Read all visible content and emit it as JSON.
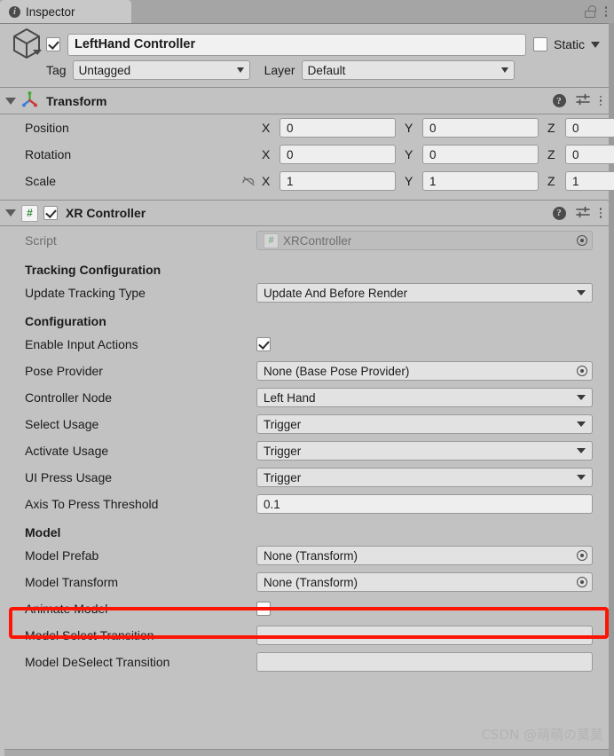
{
  "window": {
    "tab_label": "Inspector",
    "tab_icon": "info-icon",
    "lock_icon": "lock-open-icon",
    "menu_icon": "kebab-menu-icon"
  },
  "gameobject": {
    "icon": "cube-icon",
    "enabled": true,
    "name": "LeftHand Controller",
    "static_label": "Static",
    "static_checked": false,
    "tag_label": "Tag",
    "tag_value": "Untagged",
    "layer_label": "Layer",
    "layer_value": "Default"
  },
  "transform": {
    "icon": "transform-gizmo-icon",
    "title": "Transform",
    "help_icon": "help-icon",
    "preset_icon": "preset-sliders-icon",
    "menu_icon": "kebab-menu-icon",
    "rows": [
      {
        "label": "Position",
        "x": "0",
        "y": "0",
        "z": "0",
        "lock": false
      },
      {
        "label": "Rotation",
        "x": "0",
        "y": "0",
        "z": "0",
        "lock": false
      },
      {
        "label": "Scale",
        "x": "1",
        "y": "1",
        "z": "1",
        "lock": true
      }
    ],
    "axes": [
      "X",
      "Y",
      "Z"
    ]
  },
  "xr_controller": {
    "script_badge": "#",
    "enabled": true,
    "title": "XR Controller",
    "help_icon": "help-icon",
    "preset_icon": "preset-sliders-icon",
    "menu_icon": "kebab-menu-icon",
    "script_row": {
      "label": "Script",
      "value": "XRController",
      "badge": "#"
    },
    "sections": [
      {
        "header": "Tracking Configuration",
        "rows": [
          {
            "type": "dropdown",
            "label": "Update Tracking Type",
            "value": "Update And Before Render"
          }
        ]
      },
      {
        "header": "Configuration",
        "rows": [
          {
            "type": "checkbox",
            "label": "Enable Input Actions",
            "checked": true
          },
          {
            "type": "object",
            "label": "Pose Provider",
            "value": "None (Base Pose Provider)"
          },
          {
            "type": "dropdown",
            "label": "Controller Node",
            "value": "Left Hand"
          },
          {
            "type": "dropdown",
            "label": "Select Usage",
            "value": "Trigger"
          },
          {
            "type": "dropdown",
            "label": "Activate Usage",
            "value": "Trigger"
          },
          {
            "type": "dropdown",
            "label": "UI Press Usage",
            "value": "Trigger"
          },
          {
            "type": "text",
            "label": "Axis To Press Threshold",
            "value": "0.1"
          }
        ]
      },
      {
        "header": "Model",
        "rows": [
          {
            "type": "object",
            "label": "Model Prefab",
            "value": "None (Transform)",
            "highlighted": true
          },
          {
            "type": "object",
            "label": "Model Transform",
            "value": "None (Transform)"
          },
          {
            "type": "checkbox",
            "label": "Animate Model",
            "checked": false
          },
          {
            "type": "empty",
            "label": "Model Select Transition",
            "value": ""
          },
          {
            "type": "empty",
            "label": "Model DeSelect Transition",
            "value": ""
          }
        ]
      }
    ]
  },
  "highlight": {
    "color": "#fc1505",
    "target": "Model Prefab"
  },
  "watermark": {
    "text": "CSDN @萌萌の莫莫"
  },
  "colors": {
    "panel_bg": "#c2c2c2",
    "window_bg": "#9b9b9b",
    "tab_bg": "#c8c8c8",
    "field_bg": "#eeeeee",
    "object_field_bg": "#e2e2e2",
    "separator": "#8f8f8f",
    "script_green": "#2f8a3c",
    "highlight_red": "#fc1505"
  }
}
